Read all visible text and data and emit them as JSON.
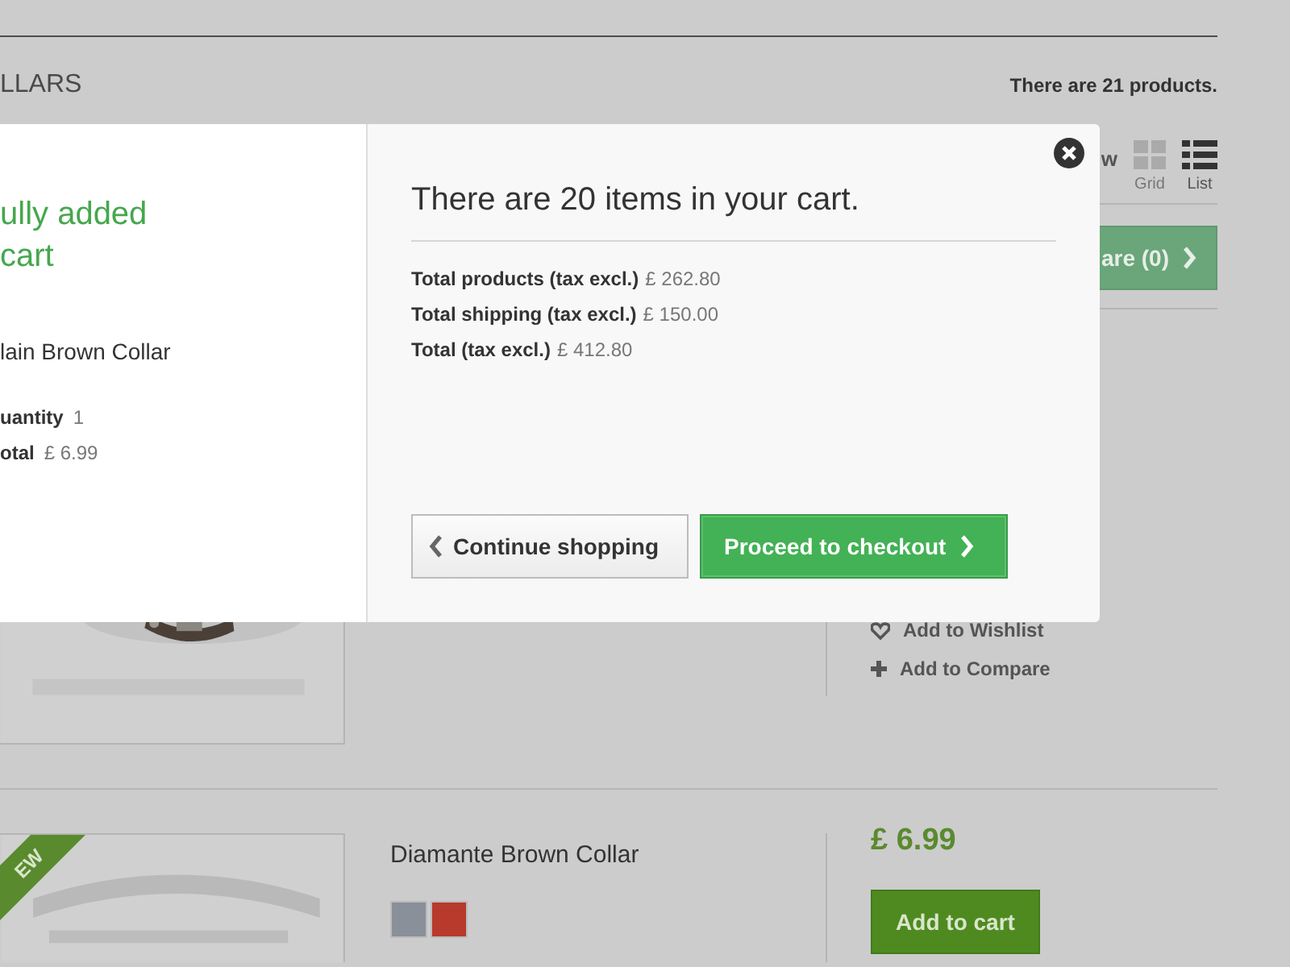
{
  "category_heading": "LLARS",
  "product_count": "There are 21 products.",
  "view": {
    "label": "w",
    "options": [
      {
        "kind": "grid",
        "label": "Grid",
        "selected": false
      },
      {
        "kind": "list",
        "label": "List",
        "selected": true
      }
    ]
  },
  "compare_button": {
    "label": "are (0)"
  },
  "products": [
    {
      "picture": {
        "kind": "picture"
      },
      "links": [
        {
          "kind": "wishlist",
          "label": "Add to Wishlist"
        },
        {
          "kind": "compare",
          "label": "Add to Compare"
        }
      ]
    },
    {
      "picture": {
        "kind": "picture"
      },
      "badge": "EW",
      "name": "Diamante Brown Collar",
      "colors": [
        {
          "color": "#8a9099"
        },
        {
          "color": "#b83a2c"
        }
      ],
      "price": "£ 6.99",
      "button": "Add to cart"
    }
  ],
  "modal": {
    "added": {
      "message": "ully added\ncart",
      "product": "lain Brown Collar",
      "details": [
        {
          "label": "uantity",
          "value": "1"
        },
        {
          "label": "otal",
          "value": "£ 6.99"
        }
      ]
    },
    "summary": {
      "title": "There are 20 items in your cart.",
      "lines": [
        {
          "label": "Total products (tax excl.)",
          "value": "£ 262.80"
        },
        {
          "label": "Total shipping (tax excl.)",
          "value": "£ 150.00"
        },
        {
          "label": "Total (tax excl.)",
          "value": "£ 412.80"
        }
      ]
    },
    "buttons": [
      {
        "kind": "back",
        "label": "Continue shopping"
      },
      {
        "kind": "primary",
        "label": "Proceed to checkout"
      }
    ]
  }
}
